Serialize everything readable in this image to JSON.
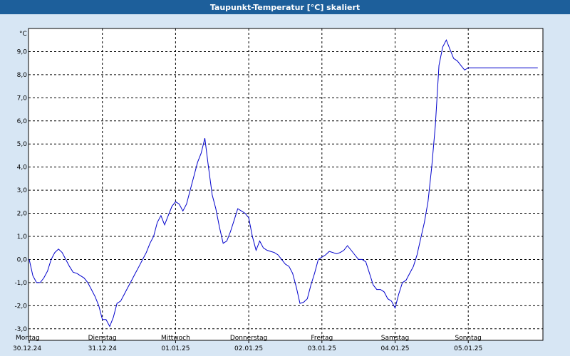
{
  "window": {
    "title": "Taupunkt-Temperatur [°C] skaliert"
  },
  "colors": {
    "background": "#d7e6f4",
    "titlebar": "#1d5f9b",
    "plot": "#ffffff",
    "line": "#0000cc",
    "grid": "#000000"
  },
  "chart_data": {
    "type": "line",
    "title": "Taupunkt-Temperatur [°C] skaliert",
    "unit": "°C",
    "ylim": [
      -3.5,
      10.0
    ],
    "yticks": [
      {
        "value": 9.0,
        "label": "9,0"
      },
      {
        "value": 8.0,
        "label": "8,0"
      },
      {
        "value": 7.0,
        "label": "7,0"
      },
      {
        "value": 6.0,
        "label": "6,0"
      },
      {
        "value": 5.0,
        "label": "5,0"
      },
      {
        "value": 4.0,
        "label": "4,0"
      },
      {
        "value": 3.0,
        "label": "3,0"
      },
      {
        "value": 2.0,
        "label": "2,0"
      },
      {
        "value": 1.0,
        "label": "1,0"
      },
      {
        "value": 0.0,
        "label": "0,0"
      },
      {
        "value": -1.0,
        "label": "-1,0"
      },
      {
        "value": -2.0,
        "label": "-2,0"
      },
      {
        "value": -3.0,
        "label": "-3,0"
      }
    ],
    "xlim": [
      0,
      7
    ],
    "days": [
      {
        "weekday": "Montag",
        "date": "30.12.24"
      },
      {
        "weekday": "Dienstag",
        "date": "31.12.24"
      },
      {
        "weekday": "Mittwoch",
        "date": "01.01.25"
      },
      {
        "weekday": "Donnerstag",
        "date": "02.01.25"
      },
      {
        "weekday": "Freitag",
        "date": "03.01.25"
      },
      {
        "weekday": "Samstag",
        "date": "04.01.25"
      },
      {
        "weekday": "Sonntag",
        "date": "05.01.25"
      }
    ],
    "grid": true,
    "series": [
      {
        "x": [
          0,
          0.05,
          0.1,
          0.15,
          0.2,
          0.25,
          0.3,
          0.35,
          0.4,
          0.45,
          0.5,
          0.55,
          0.6,
          0.65,
          0.7,
          0.75,
          0.8,
          0.85,
          0.9,
          0.95,
          1.0,
          1.05,
          1.1,
          1.15,
          1.2,
          1.25,
          1.3,
          1.35,
          1.4,
          1.45,
          1.5,
          1.55,
          1.6,
          1.65,
          1.7,
          1.75,
          1.8,
          1.85,
          1.9,
          1.95,
          2.0,
          2.05,
          2.1,
          2.15,
          2.2,
          2.25,
          2.3,
          2.35,
          2.4,
          2.45,
          2.5,
          2.55,
          2.6,
          2.65,
          2.7,
          2.75,
          2.8,
          2.85,
          2.9,
          2.95,
          3.0,
          3.05,
          3.1,
          3.15,
          3.2,
          3.25,
          3.3,
          3.35,
          3.4,
          3.45,
          3.5,
          3.55,
          3.6,
          3.65,
          3.7,
          3.75,
          3.8,
          3.85,
          3.9,
          3.95,
          4.0,
          4.05,
          4.1,
          4.15,
          4.2,
          4.25,
          4.3,
          4.35,
          4.4,
          4.45,
          4.5,
          4.55,
          4.6,
          4.65,
          4.7,
          4.75,
          4.8,
          4.85,
          4.9,
          4.95,
          5.0,
          5.05,
          5.1,
          5.15,
          5.2,
          5.25,
          5.3,
          5.35,
          5.4,
          5.45,
          5.5,
          5.55,
          5.6,
          5.65,
          5.7,
          5.75,
          5.8,
          5.85,
          5.9,
          5.95,
          6.0,
          6.05,
          6.1,
          6.15,
          6.2,
          6.25,
          6.3,
          6.35,
          6.4,
          6.45,
          6.5,
          6.55,
          6.6,
          6.65,
          6.7,
          6.75,
          6.8,
          6.85,
          6.9,
          6.95,
          7.0
        ],
        "y": [
          0.0,
          -0.7,
          -1.0,
          -1.0,
          -0.8,
          -0.5,
          0.0,
          0.3,
          0.45,
          0.3,
          0.0,
          -0.3,
          -0.55,
          -0.6,
          -0.7,
          -0.8,
          -1.0,
          -1.3,
          -1.6,
          -2.0,
          -2.6,
          -2.6,
          -2.9,
          -2.5,
          -1.9,
          -1.8,
          -1.5,
          -1.2,
          -0.9,
          -0.6,
          -0.3,
          0.0,
          0.3,
          0.7,
          1.0,
          1.6,
          1.9,
          1.5,
          1.9,
          2.3,
          2.5,
          2.4,
          2.1,
          2.4,
          3.0,
          3.6,
          4.2,
          4.6,
          5.25,
          4.0,
          2.8,
          2.2,
          1.4,
          0.7,
          0.8,
          1.2,
          1.7,
          2.2,
          2.1,
          2.0,
          1.8,
          1.0,
          0.4,
          0.8,
          0.5,
          0.4,
          0.35,
          0.3,
          0.2,
          0.0,
          -0.2,
          -0.3,
          -0.6,
          -1.2,
          -1.9,
          -1.85,
          -1.7,
          -1.1,
          -0.6,
          0.0,
          0.1,
          0.2,
          0.35,
          0.3,
          0.25,
          0.3,
          0.4,
          0.6,
          0.4,
          0.2,
          0.0,
          0.0,
          -0.1,
          -0.6,
          -1.1,
          -1.3,
          -1.3,
          -1.4,
          -1.7,
          -1.8,
          -2.1,
          -1.5,
          -1.0,
          -0.9,
          -0.6,
          -0.3,
          0.2,
          0.9,
          1.6,
          2.5,
          4.0,
          5.8,
          8.4,
          9.2,
          9.5,
          9.1,
          8.7,
          8.6,
          8.4,
          8.2,
          8.3,
          8.3,
          8.3,
          8.3,
          8.3,
          8.3,
          8.3,
          8.3,
          8.3,
          8.3,
          8.3,
          8.3,
          8.3,
          8.3,
          8.3,
          8.3,
          8.3,
          8.3,
          8.3,
          8.3,
          8.3
        ]
      }
    ]
  }
}
